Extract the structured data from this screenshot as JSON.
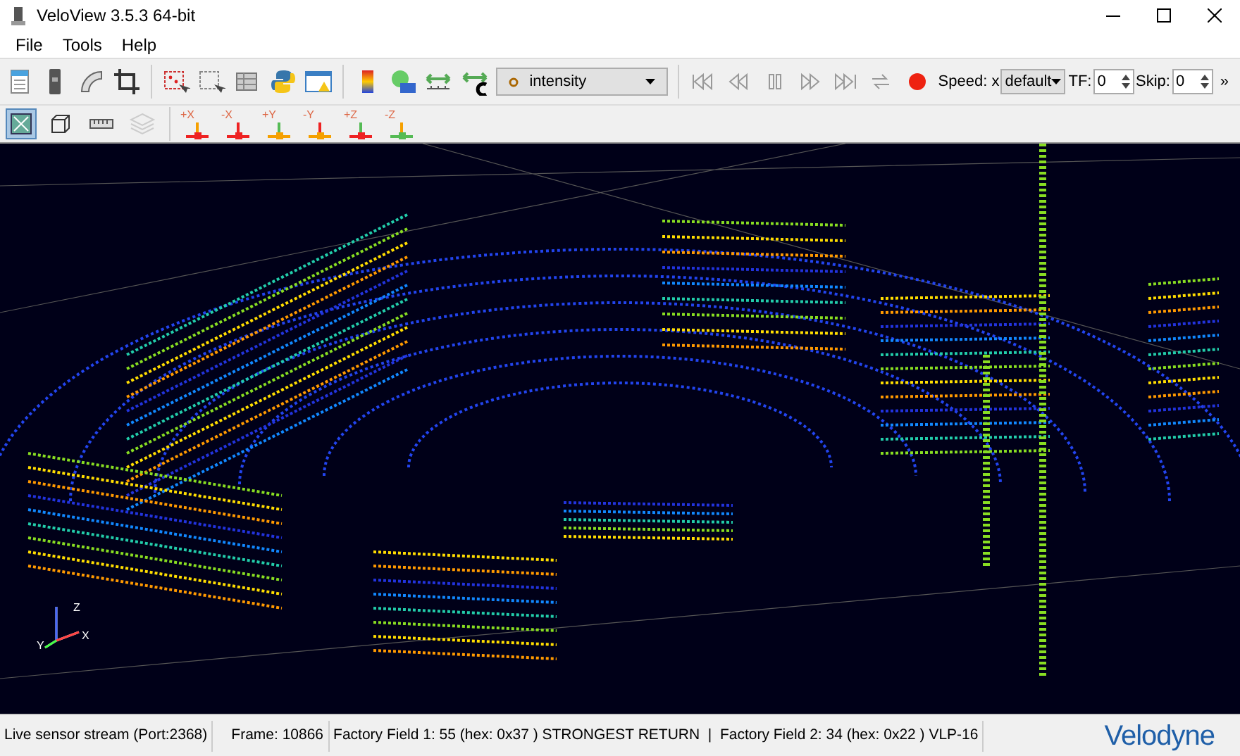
{
  "window": {
    "title": "VeloView 3.5.3 64-bit"
  },
  "menu": [
    "File",
    "Tools",
    "Help"
  ],
  "toolbar": {
    "color_by": "intensity",
    "speed_label": "Speed: x",
    "speed_value": "default",
    "tf_label": "TF:",
    "tf_value": "0",
    "skip_label": "Skip:",
    "skip_value": "0",
    "overflow": "»"
  },
  "axis_buttons": [
    {
      "label": "+X"
    },
    {
      "label": "-X"
    },
    {
      "label": "+Y"
    },
    {
      "label": "-Y"
    },
    {
      "label": "+Z"
    },
    {
      "label": "-Z"
    }
  ],
  "viewport": {
    "axes": [
      "Z",
      "X",
      "Y"
    ]
  },
  "status_bar": {
    "fields": [
      "Live sensor stream (Port:2368)",
      "Frame: 10866",
      "Factory Field 1: 55 (hex: 0x37 ) STRONGEST RETURN  |  Factory Field 2: 34 (hex: 0x22 ) VLP-16"
    ],
    "logo": "Velodyne"
  }
}
